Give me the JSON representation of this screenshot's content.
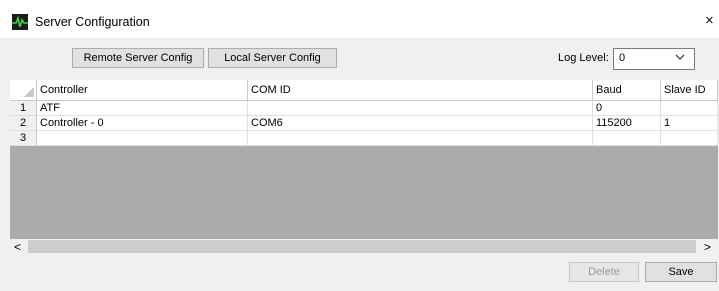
{
  "window": {
    "title": "Server Configuration",
    "icon": "server-config-icon",
    "close_glyph": "×"
  },
  "toolbar": {
    "remote_label": "Remote Server Config",
    "local_label": "Local Server Config",
    "log_level_label": "Log Level:",
    "log_level_value": "0"
  },
  "grid": {
    "columns": [
      "Controller",
      "COM ID",
      "Baud",
      "Slave ID"
    ],
    "rows": [
      {
        "num": "1",
        "controller": "ATF",
        "com_id": "",
        "baud": "0",
        "slave_id": ""
      },
      {
        "num": "2",
        "controller": "Controller - 0",
        "com_id": "COM6",
        "baud": "115200",
        "slave_id": "1"
      },
      {
        "num": "3",
        "controller": "",
        "com_id": "",
        "baud": "",
        "slave_id": ""
      }
    ]
  },
  "scrollbar": {
    "left_glyph": "<",
    "right_glyph": ">"
  },
  "footer": {
    "delete_label": "Delete",
    "save_label": "Save"
  }
}
